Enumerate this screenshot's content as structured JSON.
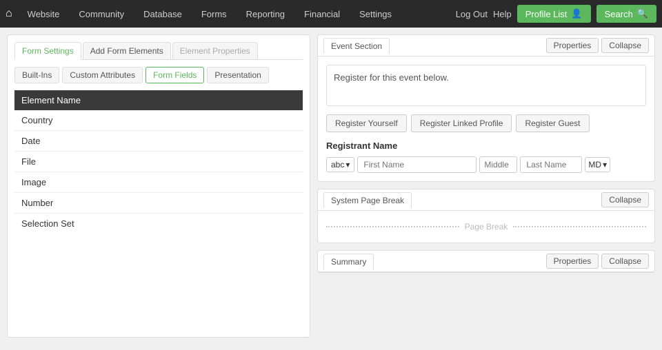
{
  "nav": {
    "home_icon": "⌂",
    "items": [
      "Website",
      "Community",
      "Database",
      "Forms",
      "Reporting",
      "Financial",
      "Settings"
    ],
    "right": {
      "logout": "Log Out",
      "help": "Help",
      "profile_list": "Profile List",
      "search": "Search"
    }
  },
  "left_panel": {
    "tabs": [
      {
        "label": "Form Settings",
        "state": "active"
      },
      {
        "label": "Add Form Elements",
        "state": "normal"
      },
      {
        "label": "Element Properties",
        "state": "disabled"
      }
    ],
    "sub_tabs": [
      {
        "label": "Built-Ins",
        "state": "normal"
      },
      {
        "label": "Custom Attributes",
        "state": "normal"
      },
      {
        "label": "Form Fields",
        "state": "active"
      },
      {
        "label": "Presentation",
        "state": "normal"
      }
    ],
    "table": {
      "header": "Element Name",
      "rows": [
        "Country",
        "Date",
        "File",
        "Image",
        "Number",
        "Selection Set"
      ]
    }
  },
  "event_section": {
    "title": "Event Section",
    "tabs": [
      "Properties",
      "Collapse"
    ],
    "body_text": "Register for this event below.",
    "register_buttons": [
      "Register Yourself",
      "Register Linked Profile",
      "Register Guest"
    ],
    "registrant_label": "Registrant Name",
    "field_type": "abc",
    "placeholders": {
      "first_name": "First Name",
      "middle": "Middle",
      "last_name": "Last Name",
      "suffix": "MD"
    }
  },
  "page_break_section": {
    "title": "System Page Break",
    "collapse_btn": "Collapse",
    "page_break_label": "Page Break"
  },
  "summary_section": {
    "title": "Summary",
    "properties_btn": "Properties",
    "collapse_btn": "Collapse"
  }
}
